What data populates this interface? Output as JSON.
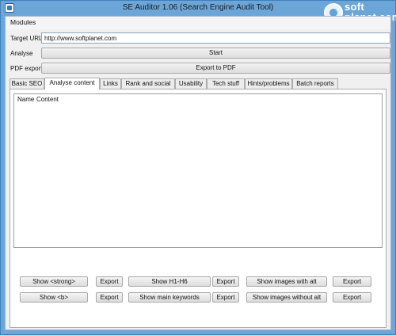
{
  "window": {
    "title": "SE Auditor 1.06 (Search Engine Audit Tool)"
  },
  "watermark": {
    "line1": "soft",
    "line2": "planet.com"
  },
  "menu": {
    "items": [
      "Modules"
    ]
  },
  "target": {
    "label": "Target URL",
    "value": "http://www.softplanet.com"
  },
  "analyse": {
    "label": "Analyse",
    "button": "Start"
  },
  "pdf": {
    "label": "PDF export",
    "button": "Export to PDF"
  },
  "tabs": [
    "Basic SEO",
    "Analyse content",
    "Links",
    "Rank and social",
    "Usability",
    "Tech stuff",
    "Hints/problems",
    "Batch reports"
  ],
  "active_tab": "Analyse content",
  "table": {
    "columns": [
      "Name",
      "Content"
    ],
    "rows": []
  },
  "buttons": {
    "show_strong": "Show <strong>",
    "show_b": "Show <b>",
    "show_h": "Show H1-H6",
    "show_keywords": "Show main keywords",
    "show_images_alt": "Show images with alt",
    "show_images_no_alt": "Show images without alt",
    "export": "Export"
  }
}
